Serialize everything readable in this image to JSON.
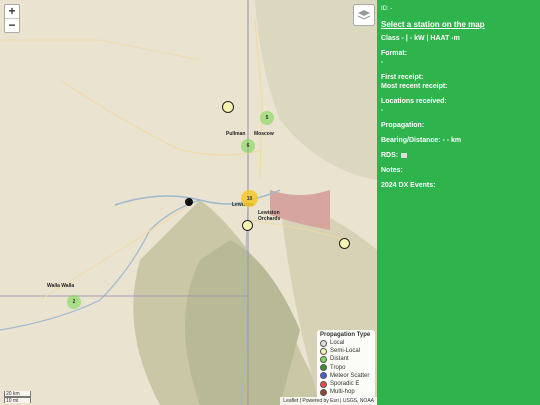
{
  "map": {
    "zoom_in": "+",
    "zoom_out": "−",
    "labels": {
      "pullman": "Pullman",
      "moscow": "Moscow",
      "lewiston": "Lewiston",
      "lewiston_orchards": "Lewiston Orchards",
      "walla_walla": "Walla Walla"
    },
    "clusters": {
      "c5": "5",
      "c6": "6",
      "c10": "10",
      "c2": "2"
    },
    "scale": {
      "miles": "20 km",
      "km": "10 mi"
    },
    "attribution": "Leaflet | Powered by Esri | USGS, NOAA"
  },
  "legend": {
    "title": "Propagation Type",
    "items": [
      {
        "label": "Local",
        "color": "#e0e0e0"
      },
      {
        "label": "Semi-Local",
        "color": "#f5f5b0"
      },
      {
        "label": "Distant",
        "color": "#7ed957"
      },
      {
        "label": "Tropo",
        "color": "#3a8f3a"
      },
      {
        "label": "Meteor Scatter",
        "color": "#4a5bd8"
      },
      {
        "label": "Sporadic E",
        "color": "#e84a4a"
      },
      {
        "label": "Multi-hop",
        "color": "#8a4a2a"
      }
    ]
  },
  "panel": {
    "id": "ID: -",
    "select": "Select a station on the map",
    "class_line": "Class - | - kW | HAAT -m",
    "format_label": "Format:",
    "format_value": "-",
    "first_receipt": "First receipt:",
    "most_recent": "Most recent receipt:",
    "locations_label": "Locations received:",
    "locations_value": "-",
    "propagation": "Propagation:",
    "bearing": "Bearing/Distance: - - km",
    "rds": "RDS:",
    "notes": "Notes:",
    "dx_events": "2024 DX Events:"
  }
}
